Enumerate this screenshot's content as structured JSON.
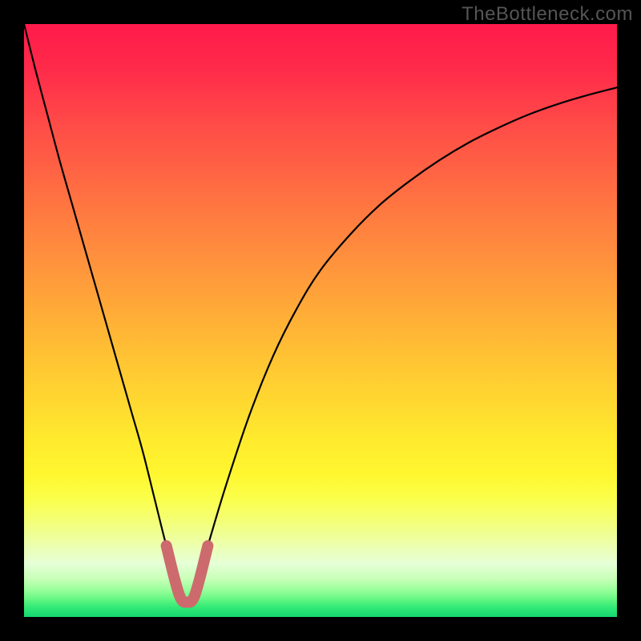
{
  "watermark": "TheBottleneck.com",
  "colors": {
    "trough_stroke": "#cc6a6d",
    "curve_stroke": "#000000"
  },
  "chart_data": {
    "type": "line",
    "title": "",
    "xlabel": "",
    "ylabel": "",
    "xlim": [
      0,
      100
    ],
    "ylim": [
      0,
      100
    ],
    "x_min_at": 27.5,
    "trough_range": [
      24,
      31
    ],
    "trough_floor_pct": 2.5,
    "series": [
      {
        "name": "bottleneck-curve",
        "x": [
          0,
          2,
          4,
          6,
          8,
          10,
          12,
          14,
          16,
          18,
          20,
          22,
          24,
          26,
          27.5,
          29,
          31,
          34,
          38,
          42,
          46,
          50,
          55,
          60,
          65,
          70,
          75,
          80,
          85,
          90,
          95,
          100
        ],
        "y": [
          100,
          92,
          84.5,
          77,
          70,
          63,
          56,
          49,
          42,
          35,
          28,
          20,
          12,
          5,
          2.5,
          5,
          12,
          22,
          34,
          44,
          52,
          58.5,
          64.5,
          69.5,
          73.5,
          77,
          80,
          82.5,
          84.7,
          86.5,
          88,
          89.3
        ]
      }
    ],
    "gradient": {
      "stops": [
        {
          "pct_from_top": 0,
          "color": "#ff1a4b"
        },
        {
          "pct_from_top": 8,
          "color": "#ff2c4a"
        },
        {
          "pct_from_top": 16,
          "color": "#ff4848"
        },
        {
          "pct_from_top": 24,
          "color": "#ff6144"
        },
        {
          "pct_from_top": 32,
          "color": "#ff7a40"
        },
        {
          "pct_from_top": 40,
          "color": "#ff923d"
        },
        {
          "pct_from_top": 48,
          "color": "#ffaa38"
        },
        {
          "pct_from_top": 56,
          "color": "#ffc233"
        },
        {
          "pct_from_top": 64,
          "color": "#ffd930"
        },
        {
          "pct_from_top": 70,
          "color": "#ffea2e"
        },
        {
          "pct_from_top": 76,
          "color": "#fff72f"
        },
        {
          "pct_from_top": 80,
          "color": "#fbff4a"
        },
        {
          "pct_from_top": 84,
          "color": "#f3ff7a"
        },
        {
          "pct_from_top": 88,
          "color": "#ecffb0"
        },
        {
          "pct_from_top": 91,
          "color": "#e6ffd8"
        },
        {
          "pct_from_top": 93.5,
          "color": "#c9ffb8"
        },
        {
          "pct_from_top": 95.5,
          "color": "#96ff9a"
        },
        {
          "pct_from_top": 97.2,
          "color": "#5cf57f"
        },
        {
          "pct_from_top": 98.5,
          "color": "#2ee876"
        },
        {
          "pct_from_top": 100,
          "color": "#16d86e"
        }
      ]
    }
  }
}
